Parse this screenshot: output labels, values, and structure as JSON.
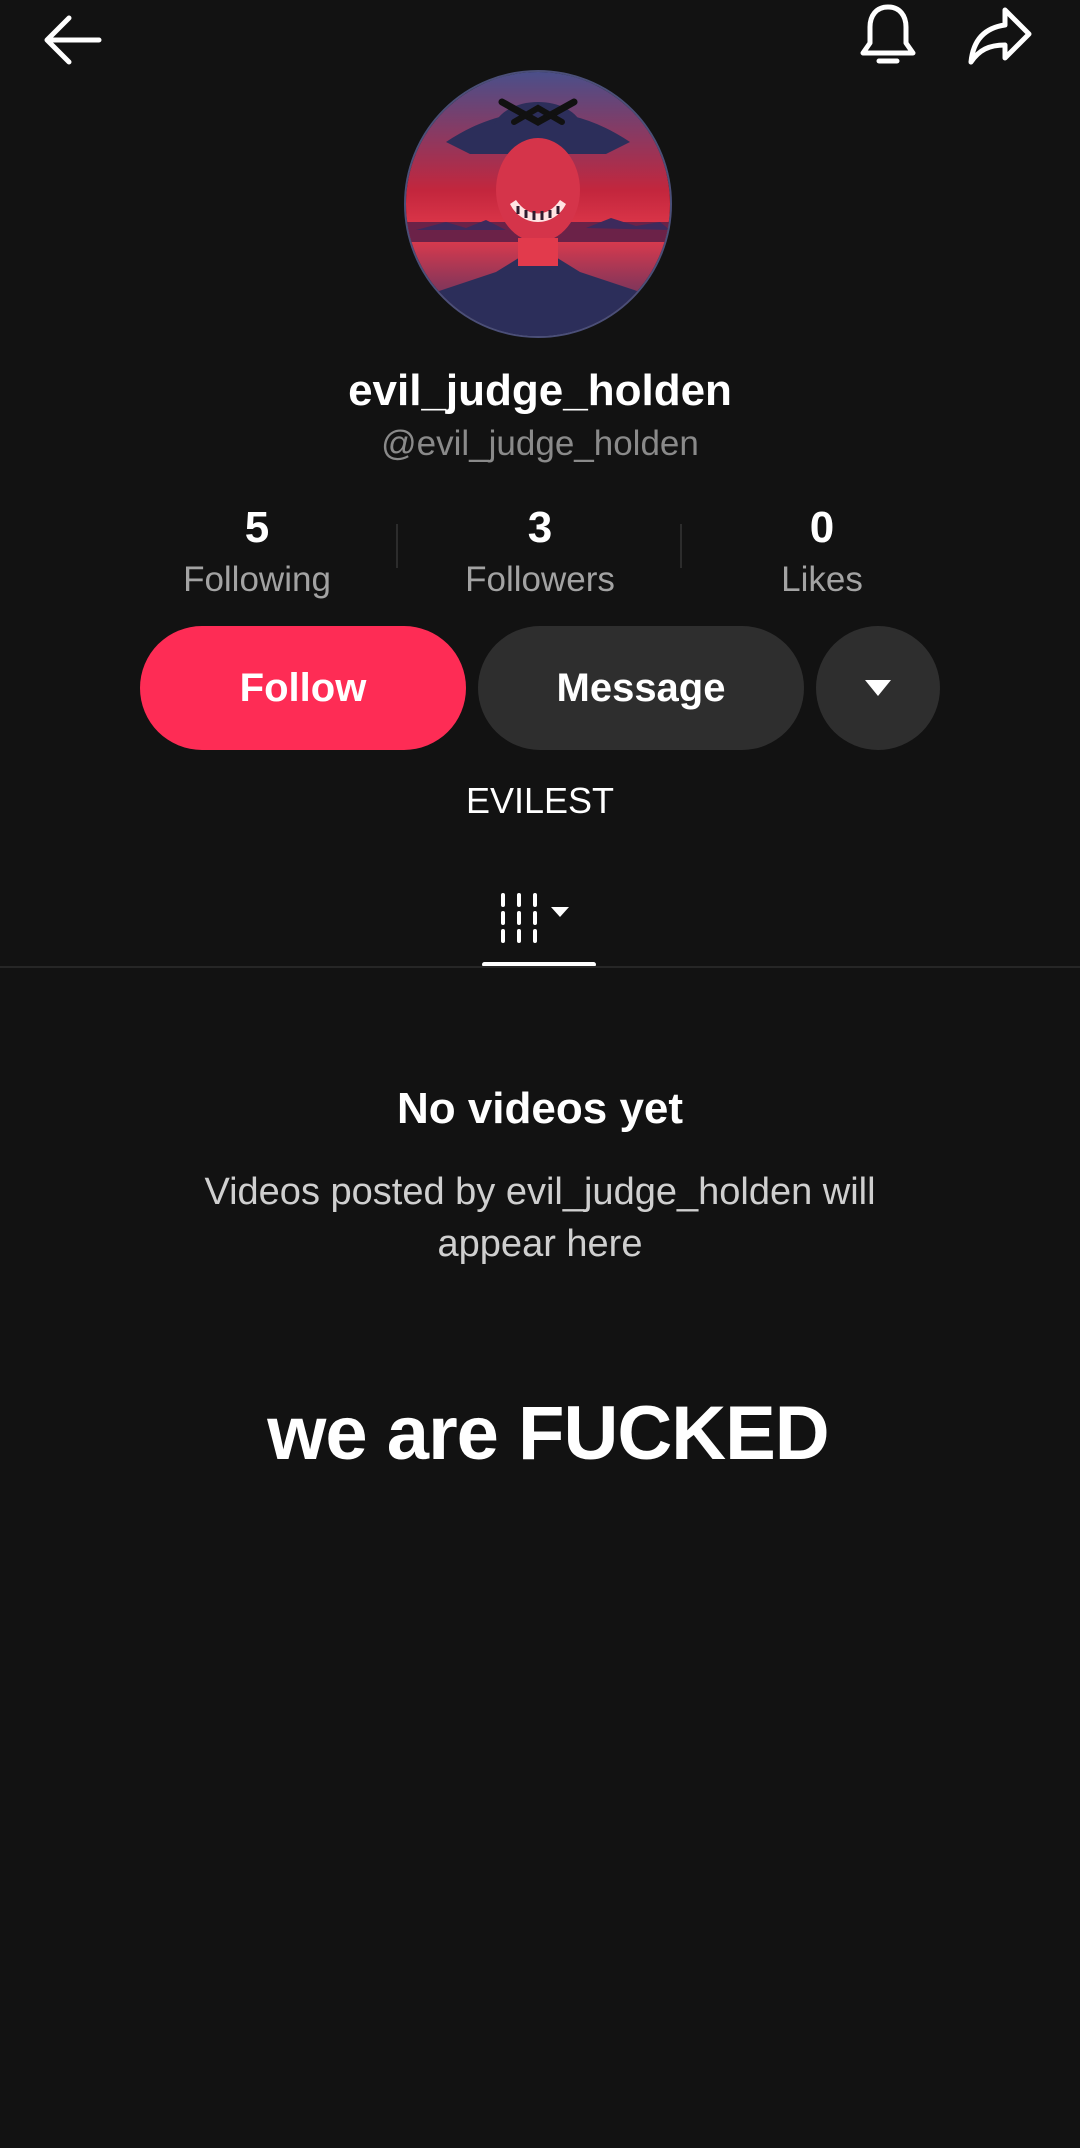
{
  "header": {
    "back_icon": "arrow-left-icon",
    "notifications_icon": "bell-icon",
    "share_icon": "share-arrow-icon"
  },
  "profile": {
    "display_name": "evil_judge_holden",
    "handle": "@evil_judge_holden",
    "bio": "EVILEST",
    "avatar_colors": [
      "#d1263d",
      "#3b3f78"
    ]
  },
  "stats": [
    {
      "value": "5",
      "label": "Following"
    },
    {
      "value": "3",
      "label": "Followers"
    },
    {
      "value": "0",
      "label": "Likes"
    }
  ],
  "actions": {
    "follow_label": "Follow",
    "message_label": "Message",
    "more_icon": "caret-down-icon"
  },
  "tabs": {
    "videos_icon": "videos-grid-icon",
    "selected": "videos"
  },
  "empty_state": {
    "title": "No videos yet",
    "description": "Videos posted by evil_judge_holden will appear here"
  },
  "overlay": {
    "caption": "we are FUCKED"
  },
  "colors": {
    "background": "#121212",
    "accent": "#fe2c55",
    "secondary_button": "#2e2e2e",
    "muted_text": "#8a8a8a"
  }
}
